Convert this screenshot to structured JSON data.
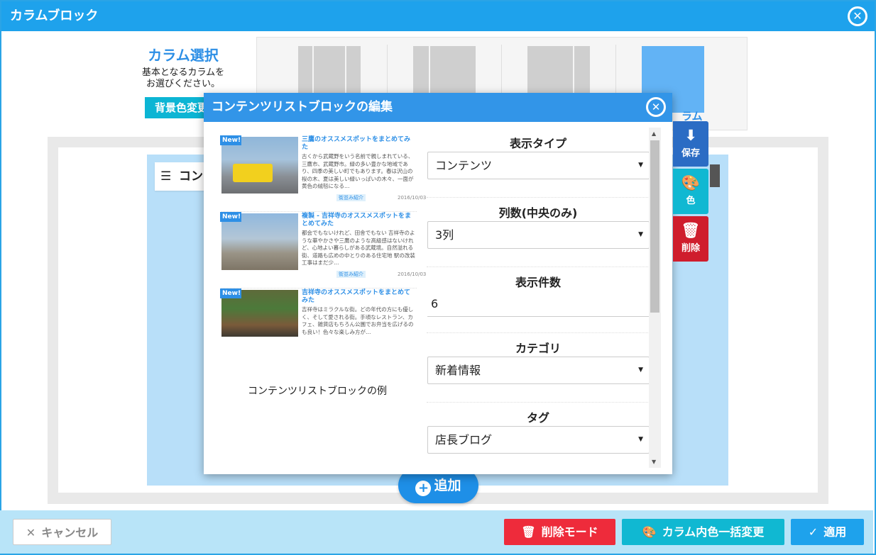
{
  "window": {
    "title": "カラムブロック",
    "close_icon": "close-icon"
  },
  "column_select": {
    "title": "カラム選択",
    "description_line1": "基本となるカラムを",
    "description_line2": "お選びください。",
    "bg_button": "背景色変更",
    "selected_label": "ラム"
  },
  "editor": {
    "block_label": "コンテンツ",
    "add_button": "追加"
  },
  "modal": {
    "title": "コンテンツリストブロックの編集",
    "example_caption": "コンテンツリストブロックの例",
    "example_items": [
      {
        "tag": "New!",
        "title": "三鷹のオススメスポットをまとめてみた",
        "body": "古くから武蔵野をいう名前で親しまれている、三鷹市、武蔵野市。緑の多い豊かな地域であり、四季の美しい町でもあります。春は沢山の桜の木、夏は美しい緑いっぱいの木々、一面が黄色の絨毯になる…",
        "category": "街並み紹介",
        "date": "2016/10/03"
      },
      {
        "tag": "New!",
        "title": "複製 - 吉祥寺のオススメスポットをまとめてみた",
        "body": "都会でもないけれど、田舎でもない 吉祥寺のような華やかさや三鷹のような高級感はないけれど、心地よい暮らしがある武蔵境。自然溢れる街、道路も広めの中とりのある住宅地 駅の改装工事はまだ少…",
        "category": "街並み紹介",
        "date": "2016/10/03"
      },
      {
        "tag": "New!",
        "title": "吉祥寺のオススメスポットをまとめてみた",
        "body": "吉祥寺はミラクルな街。どの年代の方にも優しく、そして愛される街。手頃なレストラン、カフェ、雑貨店もちろん公園でお弁当を広げるのも良い！色々な楽しみ方が…",
        "category": "",
        "date": ""
      }
    ],
    "fields": [
      {
        "label": "表示タイプ",
        "type": "select",
        "value": "コンテンツ"
      },
      {
        "label": "列数(中央のみ)",
        "type": "select",
        "value": "3列"
      },
      {
        "label": "表示件数",
        "type": "input",
        "value": "6"
      },
      {
        "label": "カテゴリ",
        "type": "select",
        "value": "新着情報"
      },
      {
        "label": "タグ",
        "type": "select",
        "value": "店長ブログ"
      }
    ],
    "side_actions": {
      "save": "保存",
      "color": "色",
      "delete": "削除"
    }
  },
  "footer": {
    "cancel": "キャンセル",
    "delete_mode": "削除モード",
    "column_color": "カラム内色一括変更",
    "apply": "適用"
  },
  "colors": {
    "accent": "#1ea2ec",
    "modal_header": "#3295e8",
    "danger": "#ee2b3b",
    "teal": "#10b8d2",
    "selected_layout": "#62b3f5"
  }
}
